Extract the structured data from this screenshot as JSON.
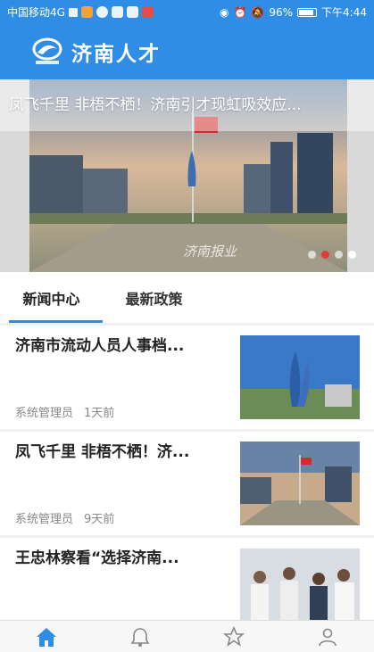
{
  "status_bar": {
    "carrier": "中国移动4G",
    "network": "4G",
    "battery": "96%",
    "time": "下午4:44"
  },
  "app": {
    "title": "济南人才",
    "logo_icon": "jinan-talent-logo"
  },
  "banner": {
    "caption": "凤飞千里 非梧不栖！济南引才现虹吸效应...",
    "watermark": "济南报业",
    "slides_total": 4,
    "active_slide": 2
  },
  "tabs": [
    {
      "label": "新闻中心",
      "active": true
    },
    {
      "label": "最新政策",
      "active": false
    }
  ],
  "news": [
    {
      "title": "济南市流动人员人事档...",
      "author": "系统管理员",
      "time": "1天前"
    },
    {
      "title": "凤飞千里 非梧不栖！济...",
      "author": "系统管理员",
      "time": "9天前"
    },
    {
      "title": "王忠林察看“选择济南...",
      "author": "",
      "time": ""
    }
  ],
  "bottom_nav": [
    {
      "icon": "home-icon",
      "active": true
    },
    {
      "icon": "bell-icon",
      "active": false
    },
    {
      "icon": "star-icon",
      "active": false
    },
    {
      "icon": "user-icon",
      "active": false
    }
  ],
  "colors": {
    "primary": "#2f8de6",
    "text": "#222222",
    "meta": "#888888",
    "dot_active": "#e23b3b"
  }
}
